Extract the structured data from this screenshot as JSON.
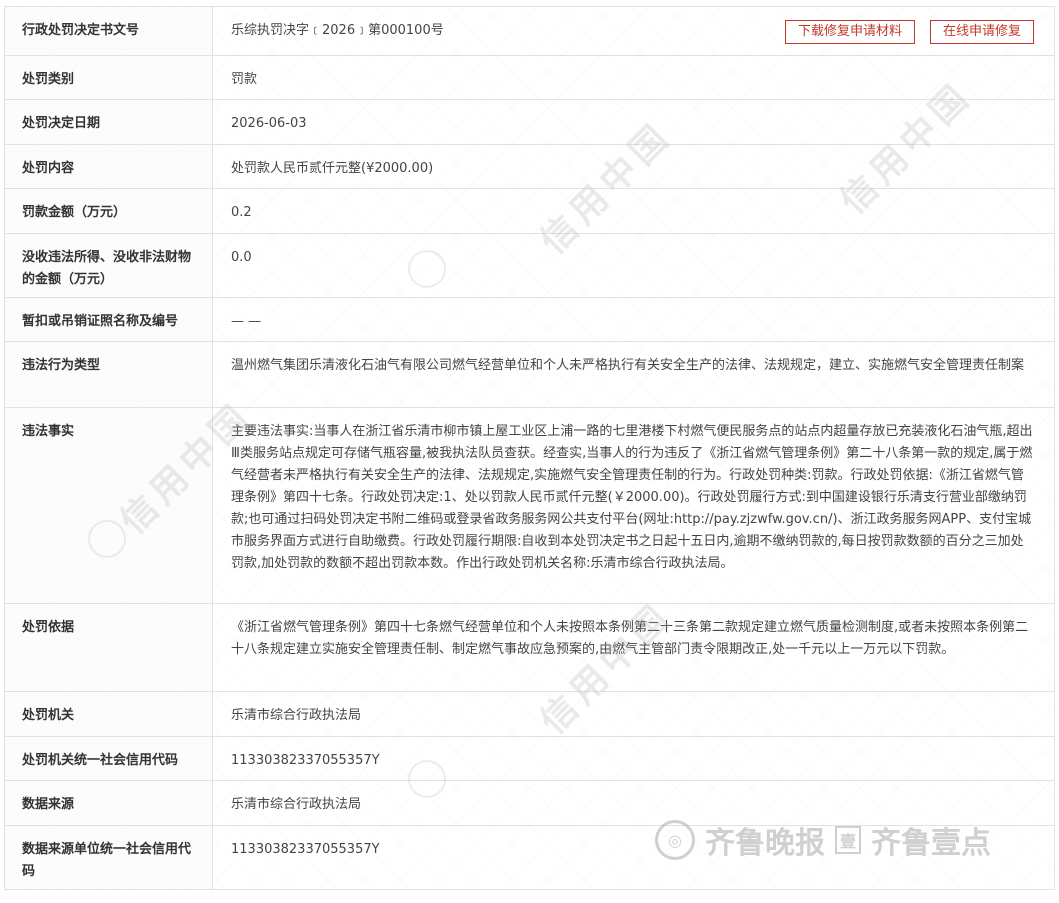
{
  "rows": [
    {
      "label": "行政处罚决定书文号",
      "value": "乐综执罚决字﹝2026﹞第000100号"
    },
    {
      "label": "处罚类别",
      "value": "罚款"
    },
    {
      "label": "处罚决定日期",
      "value": "2026-06-03"
    },
    {
      "label": "处罚内容",
      "value": "处罚款人民币贰仟元整(¥2000.00)"
    },
    {
      "label": "罚款金额（万元）",
      "value": "0.2"
    },
    {
      "label": "没收违法所得、没收非法财物的金额（万元）",
      "value": "0.0"
    },
    {
      "label": "暂扣或吊销证照名称及编号",
      "value": "— —"
    },
    {
      "label": "违法行为类型",
      "value": "温州燃气集团乐清液化石油气有限公司燃气经营单位和个人未严格执行有关安全生产的法律、法规规定，建立、实施燃气安全管理责任制案"
    },
    {
      "label": "违法事实",
      "value": "主要违法事实:当事人在浙江省乐清市柳市镇上屋工业区上浦一路的七里港楼下村燃气便民服务点的站点内超量存放已充装液化石油气瓶,超出Ⅲ类服务站点规定可存储气瓶容量,被我执法队员查获。经查实,当事人的行为违反了《浙江省燃气管理条例》第二十八条第一款的规定,属于燃气经营者未严格执行有关安全生产的法律、法规规定,实施燃气安全管理责任制的行为。行政处罚种类:罚款。行政处罚依据:《浙江省燃气管理条例》第四十七条。行政处罚决定:1、处以罚款人民币贰仟元整(￥2000.00)。行政处罚履行方式:到中国建设银行乐清支行营业部缴纳罚款;也可通过扫码处罚决定书附二维码或登录省政务服务网公共支付平台(网址:http://pay.zjzwfw.gov.cn/)、浙江政务服务网APP、支付宝城市服务界面方式进行自助缴费。行政处罚履行期限:自收到本处罚决定书之日起十五日内,逾期不缴纳罚款的,每日按罚款数额的百分之三加处罚款,加处罚款的数额不超出罚款本数。作出行政处罚机关名称:乐清市综合行政执法局。"
    },
    {
      "label": "处罚依据",
      "value": "《浙江省燃气管理条例》第四十七条燃气经营单位和个人未按照本条例第二十三条第二款规定建立燃气质量检测制度,或者未按照本条例第二十八条规定建立实施安全管理责任制、制定燃气事故应急预案的,由燃气主管部门责令限期改正,处一千元以上一万元以下罚款。"
    },
    {
      "label": "处罚机关",
      "value": "乐清市综合行政执法局"
    },
    {
      "label": "处罚机关统一社会信用代码",
      "value": "11330382337055357Y"
    },
    {
      "label": "数据来源",
      "value": "乐清市综合行政执法局"
    },
    {
      "label": "数据来源单位统一社会信用代码",
      "value": "11330382337055357Y"
    }
  ],
  "buttons": {
    "download": "下载修复申请材料",
    "apply": "在线申请修复"
  },
  "watermark": {
    "text": "信用中国",
    "brand_left": "齐鲁晚报",
    "brand_mark": "壹",
    "brand_right": "齐鲁壹点"
  }
}
